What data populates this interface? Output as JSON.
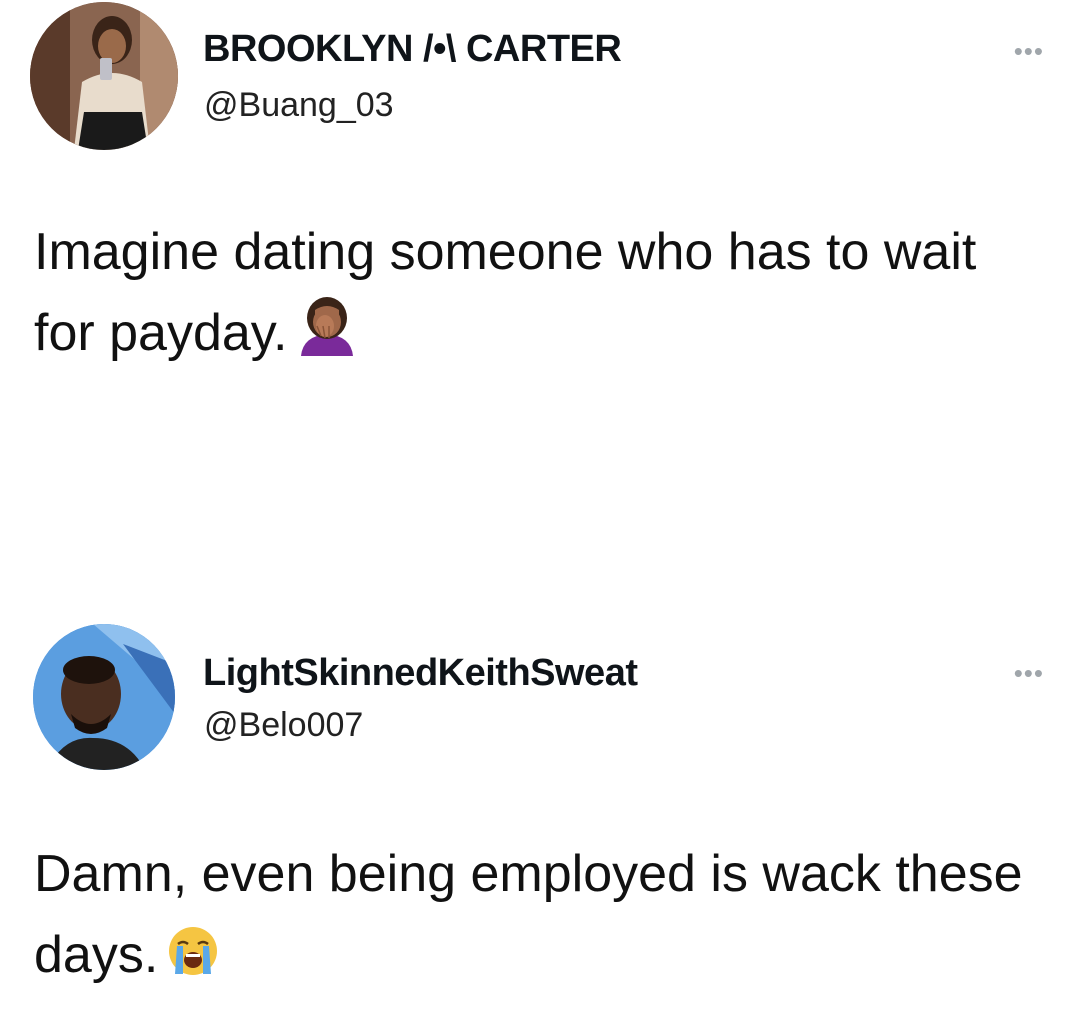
{
  "tweets": [
    {
      "display_name": "BROOKLYN /•\\ CARTER",
      "handle": "@Buang_03",
      "text": "Imagine dating someone who has to wait for payday.",
      "emoji": "woman-facepalming-icon",
      "more_label": "•••"
    },
    {
      "display_name": "LightSkinnedKeithSweat",
      "handle": "@Belo007",
      "text": "Damn, even being employed is wack these days.",
      "emoji": "loudly-crying-face-icon",
      "more_label": "•••"
    }
  ]
}
